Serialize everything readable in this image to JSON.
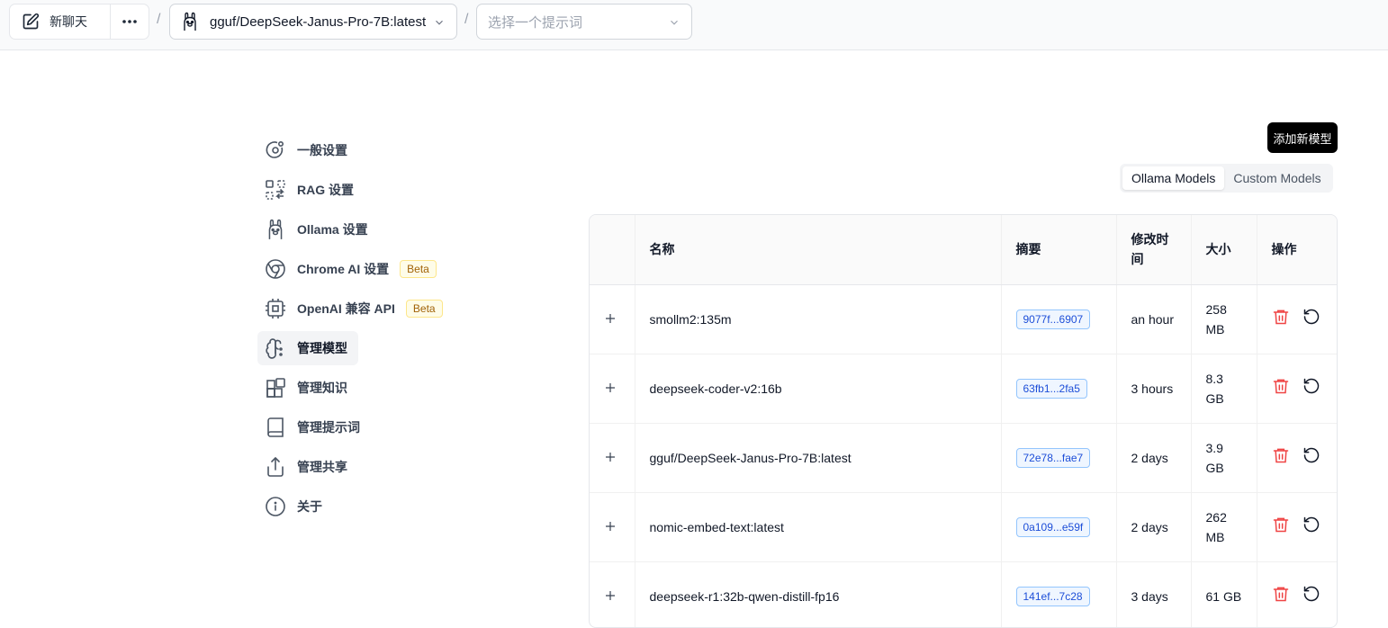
{
  "topbar": {
    "new_chat_label": "新聊天",
    "model_value": "gguf/DeepSeek-Janus-Pro-7B:latest",
    "prompt_placeholder": "选择一个提示词",
    "separator": "/"
  },
  "sidebar": {
    "items": [
      {
        "label": "一般设置",
        "icon": "settings-circle-icon"
      },
      {
        "label": "RAG 设置",
        "icon": "rag-icon"
      },
      {
        "label": "Ollama 设置",
        "icon": "ollama-icon"
      },
      {
        "label": "Chrome AI 设置",
        "icon": "chrome-icon",
        "badge": "Beta"
      },
      {
        "label": "OpenAI 兼容 API",
        "icon": "chip-icon",
        "badge": "Beta"
      },
      {
        "label": "管理模型",
        "icon": "brain-icon",
        "active": true
      },
      {
        "label": "管理知识",
        "icon": "blocks-icon"
      },
      {
        "label": "管理提示词",
        "icon": "book-icon"
      },
      {
        "label": "管理共享",
        "icon": "share-icon"
      },
      {
        "label": "关于",
        "icon": "info-icon"
      }
    ]
  },
  "main": {
    "add_button": "添加新模型",
    "tabs": [
      {
        "label": "Ollama Models",
        "selected": true
      },
      {
        "label": "Custom Models",
        "selected": false
      }
    ],
    "table": {
      "headers": [
        "名称",
        "摘要",
        "修改时间",
        "大小",
        "操作"
      ],
      "rows": [
        {
          "name": "smollm2:135m",
          "digest": "9077f...6907",
          "modified": "an hour",
          "size": "258 MB"
        },
        {
          "name": "deepseek-coder-v2:16b",
          "digest": "63fb1...2fa5",
          "modified": "3 hours",
          "size": "8.3 GB"
        },
        {
          "name": "gguf/DeepSeek-Janus-Pro-7B:latest",
          "digest": "72e78...fae7",
          "modified": "2 days",
          "size": "3.9 GB"
        },
        {
          "name": "nomic-embed-text:latest",
          "digest": "0a109...e59f",
          "modified": "2 days",
          "size": "262 MB"
        },
        {
          "name": "deepseek-r1:32b-qwen-distill-fp16",
          "digest": "141ef...7c28",
          "modified": "3 days",
          "size": "61 GB"
        }
      ]
    }
  },
  "colors": {
    "delete": "#ef4444",
    "tag_text": "#1d4ed8",
    "tag_border": "#93c5fd",
    "badge": "#a16207"
  }
}
